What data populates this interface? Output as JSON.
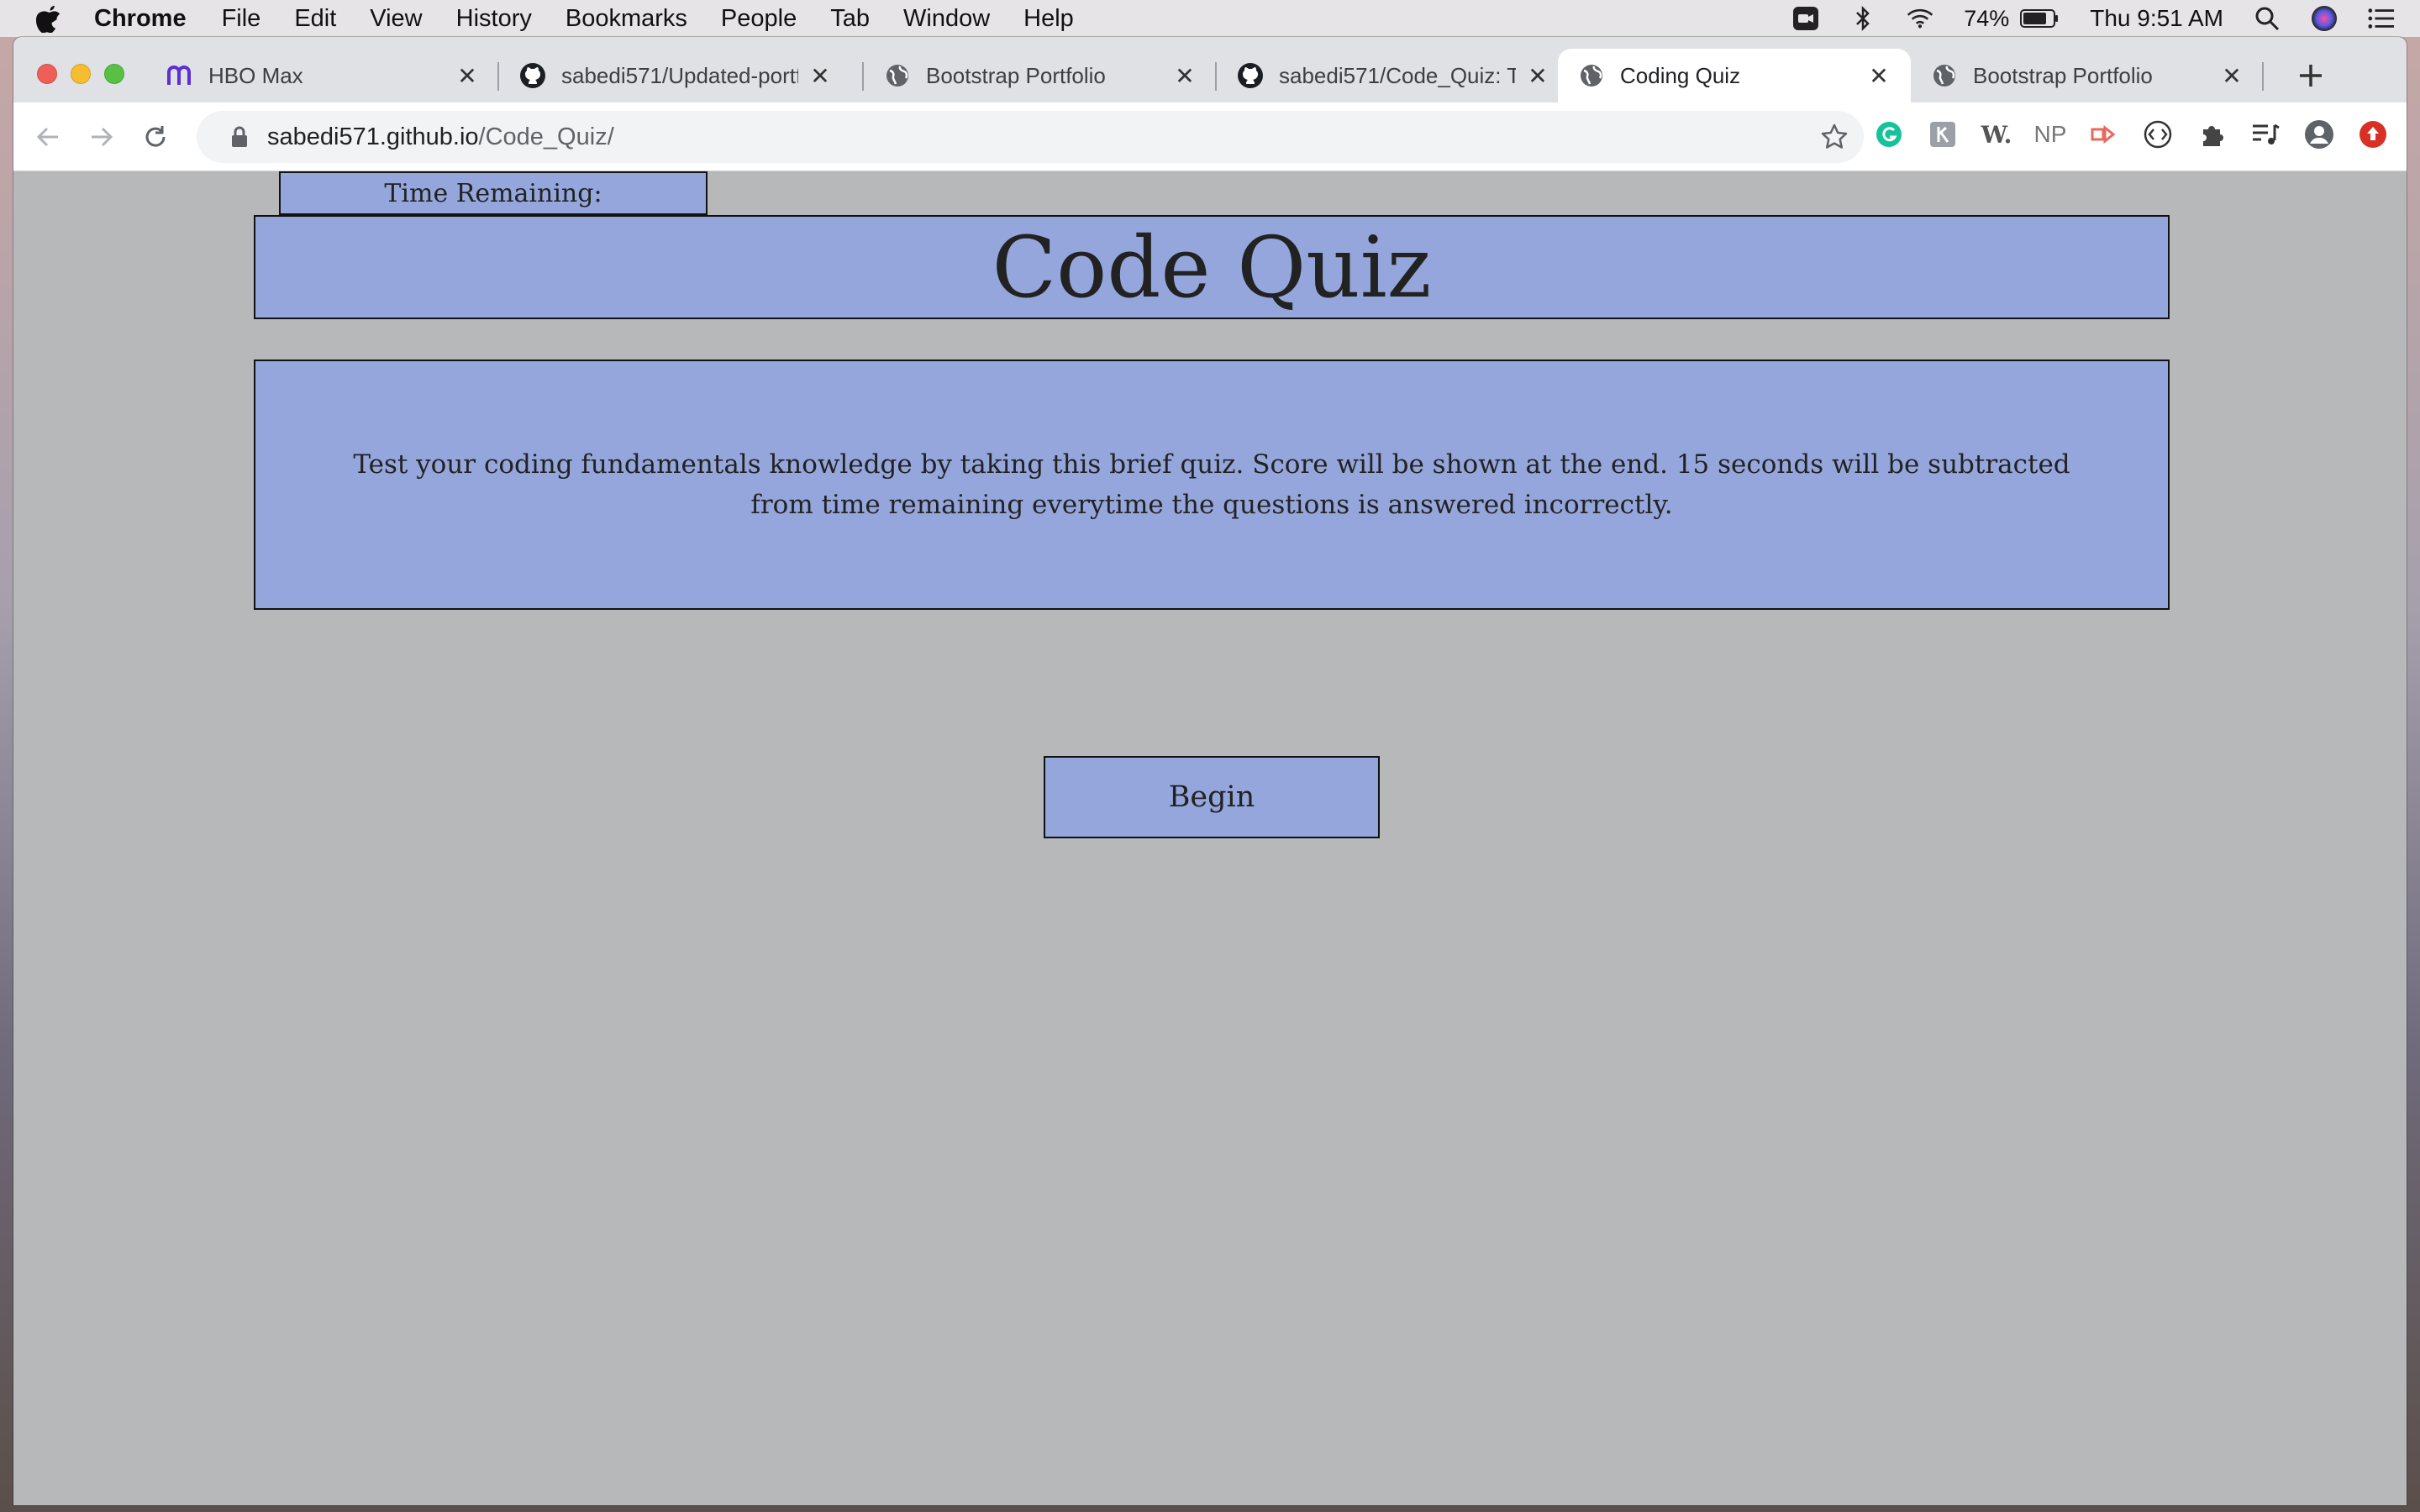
{
  "menubar": {
    "app_name": "Chrome",
    "items": [
      "File",
      "Edit",
      "View",
      "History",
      "Bookmarks",
      "People",
      "Tab",
      "Window",
      "Help"
    ],
    "battery": "74%",
    "clock": "Thu 9:51 AM"
  },
  "tabs": [
    {
      "title": "HBO Max",
      "icon": "hbo-max-icon",
      "active": false
    },
    {
      "title": "sabedi571/Updated-portf",
      "icon": "github-icon",
      "active": false
    },
    {
      "title": "Bootstrap Portfolio",
      "icon": "globe-icon",
      "active": false
    },
    {
      "title": "sabedi571/Code_Quiz: Te",
      "icon": "github-icon",
      "active": false
    },
    {
      "title": "Coding Quiz",
      "icon": "globe-icon",
      "active": true
    },
    {
      "title": "Bootstrap Portfolio",
      "icon": "globe-icon",
      "active": false
    }
  ],
  "address": {
    "host": "sabedi571.github.io",
    "path": "/Code_Quiz/"
  },
  "extensions": [
    "W.",
    "NP"
  ],
  "quiz": {
    "timer_label": "Time Remaining:",
    "title": "Code Quiz",
    "intro": "Test your coding fundamentals knowledge by taking this brief quiz. Score will be shown at the end. 15 seconds will be subtracted from time remaining everytime the questions is answered incorrectly.",
    "begin_label": "Begin"
  },
  "colors": {
    "panel": "#94a6dc",
    "page_bg": "#b7b8ba",
    "border": "#111111"
  }
}
